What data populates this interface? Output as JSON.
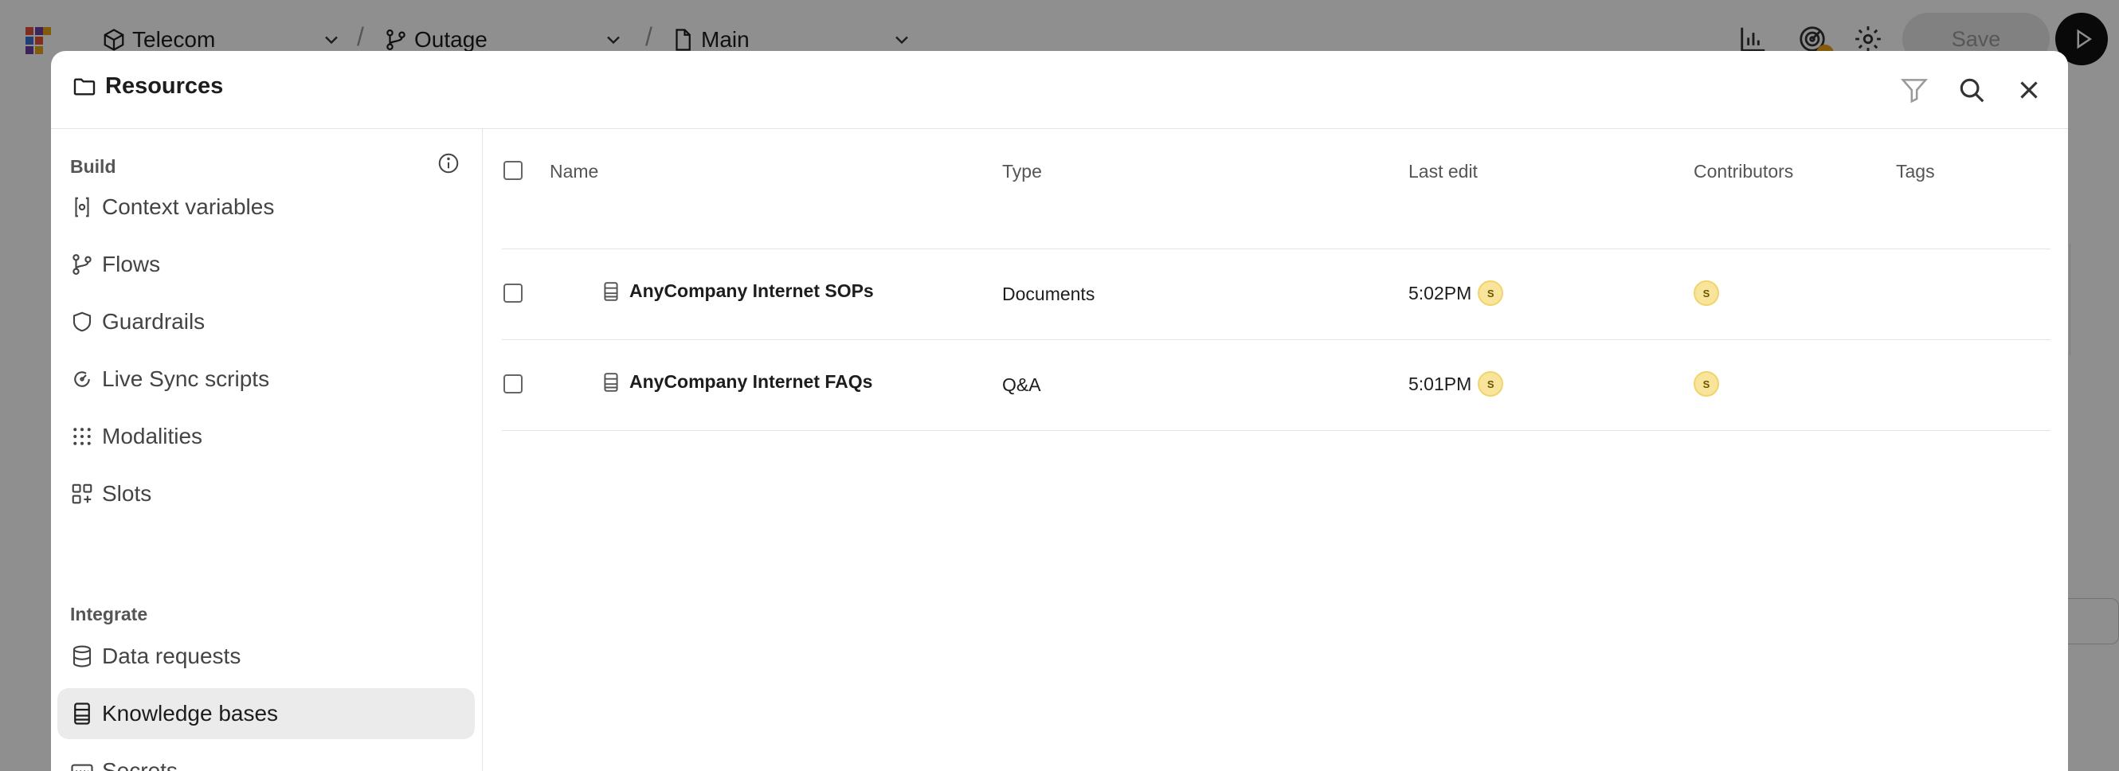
{
  "topbar": {
    "project": "Telecom",
    "flow": "Outage",
    "page": "Main",
    "save_label": "Save",
    "icons": [
      "analytics-icon",
      "radar-icon",
      "settings-icon",
      "play-icon"
    ]
  },
  "modal": {
    "title": "Resources",
    "actions": [
      "filter-icon",
      "search-icon",
      "close-icon"
    ]
  },
  "sidebar": {
    "sections": {
      "build": "Build",
      "integrate": "Integrate"
    },
    "build_items": [
      {
        "label": "Context variables",
        "icon": "context-variable-icon"
      },
      {
        "label": "Flows",
        "icon": "flow-icon"
      },
      {
        "label": "Guardrails",
        "icon": "shield-icon"
      },
      {
        "label": "Live Sync scripts",
        "icon": "sync-icon"
      },
      {
        "label": "Modalities",
        "icon": "grid-dots-icon"
      },
      {
        "label": "Slots",
        "icon": "slots-icon"
      }
    ],
    "integrate_items": [
      {
        "label": "Data requests",
        "icon": "database-icon"
      },
      {
        "label": "Knowledge bases",
        "icon": "knowledge-base-icon",
        "active": true
      },
      {
        "label": "Secrets",
        "icon": "secret-icon"
      }
    ]
  },
  "table": {
    "columns": {
      "name": "Name",
      "type": "Type",
      "last_edit": "Last edit",
      "contributors": "Contributors",
      "tags": "Tags"
    },
    "rows": [
      {
        "name": "AnyCompany Internet SOPs",
        "type": "Documents",
        "last_edit": "5:02PM",
        "editor_initial": "S",
        "contributor_initial": "S",
        "tags": ""
      },
      {
        "name": "AnyCompany Internet FAQs",
        "type": "Q&A",
        "last_edit": "5:01PM",
        "editor_initial": "S",
        "contributor_initial": "S",
        "tags": ""
      }
    ]
  },
  "colors": {
    "overlay": "#000000",
    "active_nav": "#ebebeb",
    "avatar": "#f8e49a"
  }
}
